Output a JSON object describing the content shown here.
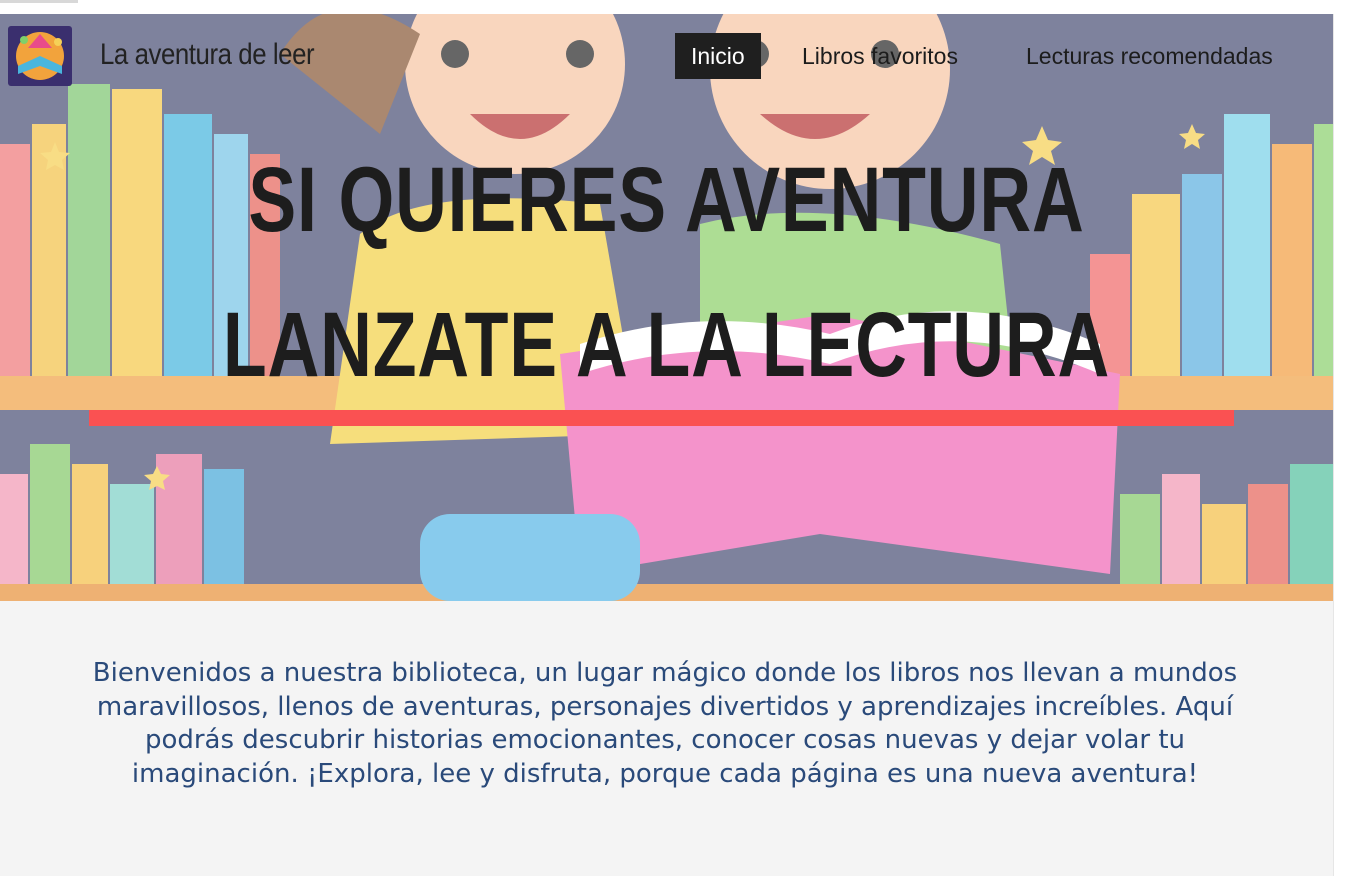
{
  "brand": {
    "name": "La aventura de leer",
    "logo_icon": "colorful-book-icon"
  },
  "nav": {
    "items": [
      {
        "label": "Inicio",
        "active": true
      },
      {
        "label": "Libros favoritos",
        "active": false
      },
      {
        "label": "Lecturas recomendadas",
        "active": false
      }
    ]
  },
  "hero": {
    "line1": "SI QUIERES AVENTURA",
    "line2": "LANZATE A LA LECTURA",
    "underline_color": "#fa5152"
  },
  "intro": {
    "text": "Bienvenidos a nuestra biblioteca, un lugar mágico donde los libros nos llevan a mundos maravillosos, llenos de aventuras, personajes divertidos y aprendizajes increíbles. Aquí podrás descubrir historias emocionantes, conocer cosas nuevas y dejar volar tu imaginación. ¡Explora, lee y disfruta, porque cada página es una nueva aventura!"
  },
  "colors": {
    "nav_active_bg": "#1f1f1f",
    "intro_text": "#2a4a7a",
    "page_bg": "#f4f4f4"
  }
}
